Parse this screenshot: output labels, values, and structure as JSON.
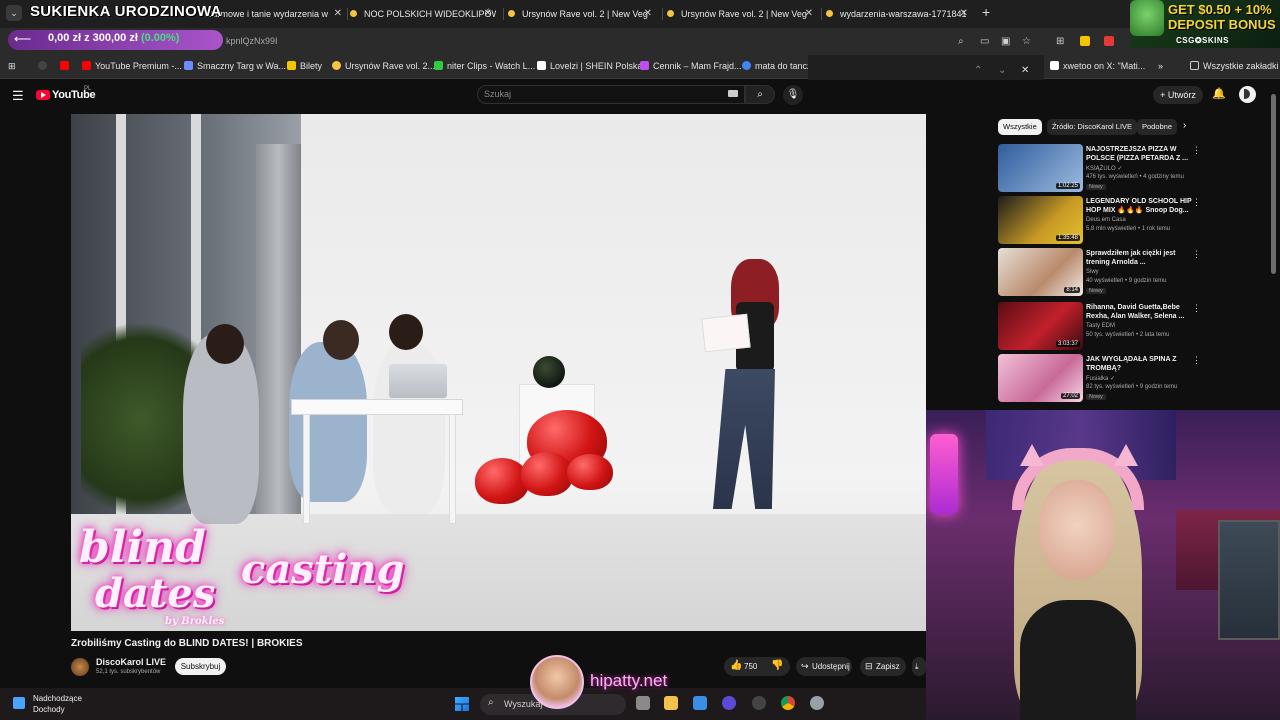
{
  "browser": {
    "tabs": [
      {
        "label": "Darmowe i tanie wydarzenia w"
      },
      {
        "label": "NOC POLSKICH WIDEOKLIPÓW"
      },
      {
        "label": "Ursynów Rave vol. 2 | New Veg"
      },
      {
        "label": "Ursynów Rave vol. 2 | New Veg"
      },
      {
        "label": "wydarzenia-warszawa-1771841"
      }
    ],
    "url_fragment": "kpnlQzNx99I",
    "bookmarks": [
      {
        "label": "YouTube Premium -...",
        "color": "#ff0000"
      },
      {
        "label": "Smaczny Targ w Wa...",
        "color": "#6b8cff"
      },
      {
        "label": "Bilety",
        "color": "#f5c400"
      },
      {
        "label": "Ursynów Rave vol. 2...",
        "color": "#f6c343"
      },
      {
        "label": "niter Clips - Watch L...",
        "color": "#2ecc40"
      },
      {
        "label": "Lovelzi | SHEIN Polska",
        "color": "#ffffff"
      },
      {
        "label": "Cennik – Mam Frajd...",
        "color": "#c04cf0"
      },
      {
        "label": "mata do tancz",
        "color": "#4285f4"
      },
      {
        "label": "xwetoo on X: \"Mati...",
        "color": "#ffffff"
      }
    ],
    "all_bookmarks": "Wszystkie zakładki"
  },
  "stream_overlay": {
    "title": "SUKIENKA URODZINOWA",
    "goal_text": "0,00 zł z 300,00 zł",
    "goal_percent": "(0.00%)",
    "promo_line1": "GET $0.50 + 10%",
    "promo_line2": "DEPOSIT BONUS",
    "promo_brand": "CSG✪SKINS",
    "watermark": "hipatty.net"
  },
  "youtube": {
    "logo": "YouTube",
    "region": "PL",
    "search_placeholder": "Szukaj",
    "create_label": "Utwórz",
    "video": {
      "overlay_line1": "blind",
      "overlay_line2": "dates",
      "overlay_line3": "casting",
      "overlay_by": "by Brokies",
      "title": "Zrobiliśmy Casting do BLIND DATES! | BROKIES",
      "channel": "DiscoKarol LIVE",
      "subscribers": "52,1 tys. subskrybentów",
      "subscribe_label": "Subskrybuj",
      "likes": "750",
      "share_label": "Udostępnij",
      "save_label": "Zapisz"
    },
    "chips": [
      {
        "label": "Wszystkie",
        "active": true
      },
      {
        "label": "Źródło: DiscoKarol LIVE",
        "active": false
      },
      {
        "label": "Podobne",
        "active": false
      }
    ],
    "recommendations": [
      {
        "title": "NAJOSTRZEJSZA PIZZA W POLSCE (PIZZA PETARDA Z ...",
        "channel": "KSIĄŻULO ✓",
        "meta": "476 tys. wyświetleń • 4 godziny temu",
        "badge": "Nowy",
        "duration": "1:02:25",
        "thumb": "#3d6fb0"
      },
      {
        "title": "LEGENDARY OLD SCHOOL HIP HOP MIX 🔥🔥🔥 Snoop Dog...",
        "channel": "Deus em Casa",
        "meta": "5,8 mln wyświetleń • 1 rok temu",
        "badge": "",
        "duration": "1:35:48",
        "thumb": "#b58a1f"
      },
      {
        "title": "Sprawdziłem jak ciężki jest trening Arnolda ...",
        "channel": "Siwy",
        "meta": "40 wyświetleń • 9 godzin temu",
        "badge": "Nowy",
        "duration": "8:14",
        "thumb": "#c4a68f"
      },
      {
        "title": "Rihanna, David Guetta,Bebe Rexha, Alan Walker, Selena ...",
        "channel": "Tasty EDM",
        "meta": "50 tys. wyświetleń • 2 lata temu",
        "badge": "",
        "duration": "3:03:37",
        "thumb": "#8a1822"
      },
      {
        "title": "JAK WYGLĄDAŁA SPINA Z TROMBĄ?",
        "channel": "Fusialka ✓",
        "meta": "82 tys. wyświetleń • 9 godzin temu",
        "badge": "Nowy",
        "duration": "27:02",
        "thumb": "#d987b3"
      }
    ]
  },
  "taskbar": {
    "weather_line1": "Nadchodzące",
    "weather_line2": "Dochody",
    "search_label": "Wyszukaj"
  }
}
